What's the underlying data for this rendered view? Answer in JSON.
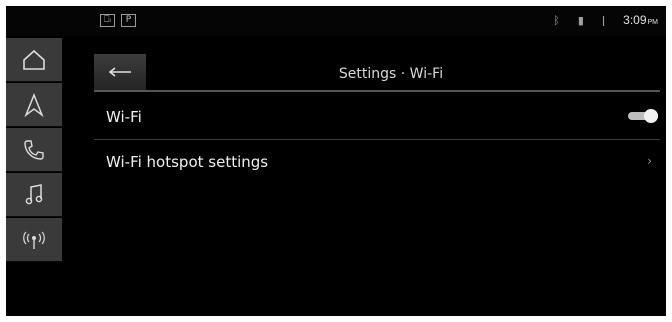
{
  "status_bar": {
    "left_icons": [
      {
        "name": "phone-connected-icon",
        "glyph": "⎕ᵢ"
      },
      {
        "name": "parking-icon",
        "glyph": "P"
      }
    ],
    "right_icons": [
      {
        "name": "bluetooth-icon",
        "glyph": "ᛒ"
      },
      {
        "name": "signal-icon",
        "glyph": "▮"
      },
      {
        "name": "battery-icon",
        "glyph": "ǀ"
      }
    ],
    "time": "3:09",
    "ampm": "PM"
  },
  "side_nav": {
    "items": [
      {
        "name": "nav-home",
        "icon": "home-icon"
      },
      {
        "name": "nav-navigation",
        "icon": "navigation-arrow-icon"
      },
      {
        "name": "nav-phone",
        "icon": "phone-icon"
      },
      {
        "name": "nav-media",
        "icon": "music-note-icon"
      },
      {
        "name": "nav-radio",
        "icon": "radio-antenna-icon"
      }
    ]
  },
  "header": {
    "title": "Settings · Wi-Fi",
    "back_icon": "back-arrow-icon"
  },
  "rows": [
    {
      "label": "Wi-Fi",
      "control": "toggle",
      "toggle_on": true
    },
    {
      "label": "Wi-Fi hotspot settings",
      "control": "chevron",
      "chevron_glyph": "›"
    }
  ],
  "colors": {
    "background": "#000000",
    "nav_tile": "#3a3a3a",
    "text": "#f0f0f0",
    "toggle_on": "#bdbdbd"
  }
}
